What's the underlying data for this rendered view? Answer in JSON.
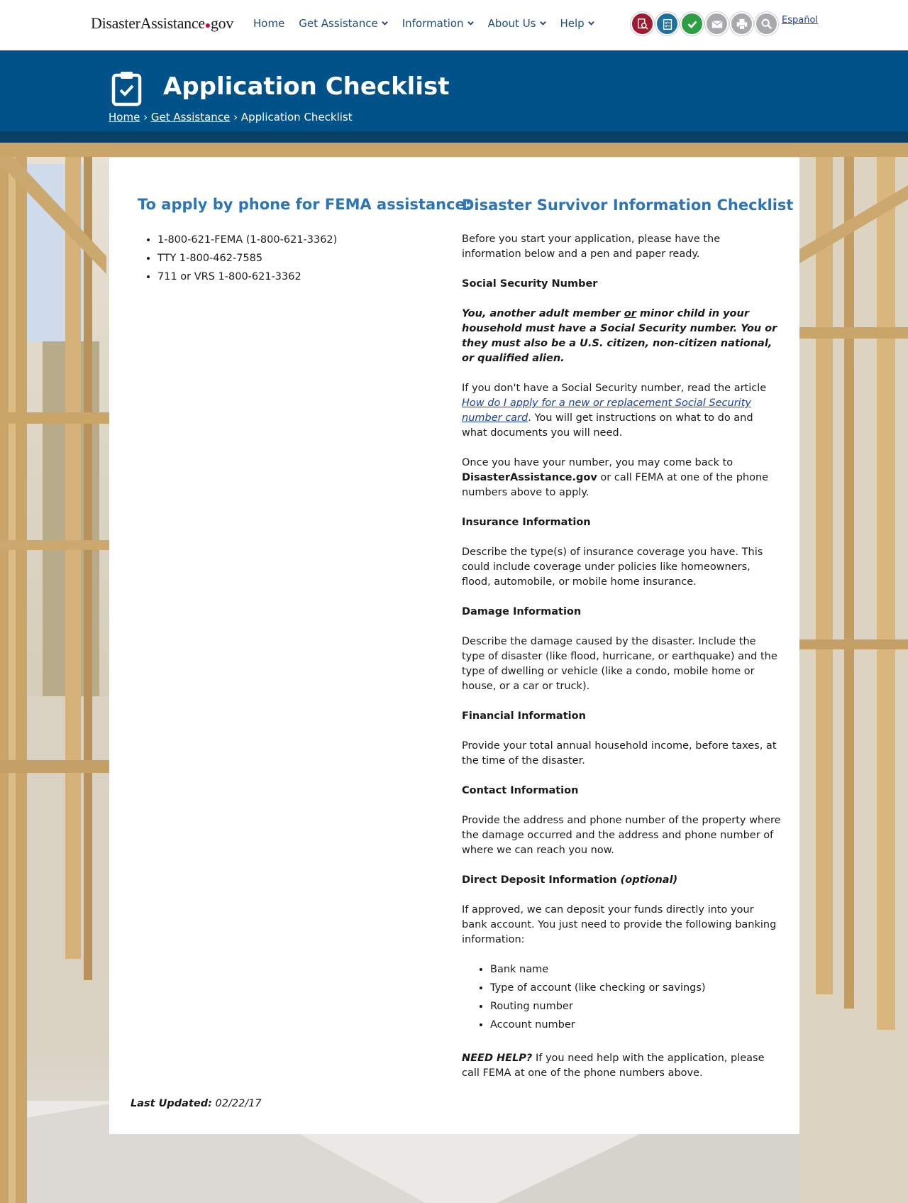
{
  "header": {
    "logo_main": "DisasterAssistance",
    "logo_dot": "●",
    "logo_suffix": "gov",
    "nav": [
      {
        "label": "Home",
        "dropdown": false
      },
      {
        "label": "Get Assistance",
        "dropdown": true
      },
      {
        "label": "Information",
        "dropdown": true
      },
      {
        "label": "About Us",
        "dropdown": true
      },
      {
        "label": "Help",
        "dropdown": true
      }
    ],
    "tools": [
      {
        "icon": "search-document-icon",
        "color": "#9e1b32"
      },
      {
        "icon": "checklist-icon",
        "color": "#1f6f9f"
      },
      {
        "icon": "checkmark-icon",
        "color": "#2e9e44"
      },
      {
        "icon": "email-icon",
        "color": "#a7a9ac"
      },
      {
        "icon": "print-icon",
        "color": "#a7a9ac"
      },
      {
        "icon": "search-icon",
        "color": "#a7a9ac"
      }
    ],
    "language_link": "Español"
  },
  "banner": {
    "title": "Application Checklist",
    "breadcrumb": {
      "home": "Home",
      "sep1": "›",
      "get_assistance": "Get Assistance",
      "sep2": "›",
      "current": "Application Checklist"
    }
  },
  "left": {
    "heading": "To apply by phone for FEMA assistance:",
    "phones": [
      "1-800-621-FEMA (1-800-621-3362)",
      "TTY 1-800-462-7585",
      "711 or VRS 1-800-621-3362"
    ]
  },
  "right": {
    "heading": "Disaster Survivor Information Checklist",
    "intro": "Before you start your application, please have the information below and a pen and paper ready.",
    "ssn": {
      "title": "Social Security Number",
      "emph_a": "You, another adult member ",
      "emph_or": "or",
      "emph_b": " minor child in your household must have a Social Security number. You or they must also be a U.S. citizen, non-citizen national, or qualified alien.",
      "no_ssn_a": "If you don't have a Social Security number, read the article ",
      "no_ssn_link": "How do I apply for a new or replacement Social Security number card",
      "no_ssn_b": ". You will get instructions on what to do and what documents you will need.",
      "return_a": "Once you have your number, you may come back to ",
      "return_site": "DisasterAssistance.gov",
      "return_b": " or call FEMA at one of the phone numbers above to apply."
    },
    "insurance": {
      "title": "Insurance Information",
      "text": "Describe the type(s) of insurance coverage you have. This could include coverage under policies like homeowners, flood, automobile, or mobile home insurance."
    },
    "damage": {
      "title": "Damage Information",
      "text": "Describe the damage caused by the disaster. Include the type of disaster (like flood, hurricane, or earthquake) and the type of dwelling or vehicle (like a condo, mobile home or house, or a car or truck)."
    },
    "financial": {
      "title": "Financial Information",
      "text": "Provide your total annual household income, before taxes, at the time of the disaster."
    },
    "contact": {
      "title": "Contact Information",
      "text": "Provide the address and phone number of the property where the damage occurred and the address and phone number of where we can reach you now."
    },
    "deposit": {
      "title": "Direct Deposit Information",
      "optional": "(optional)",
      "text": "If approved, we can deposit your funds directly into your bank account. You just need to provide the following banking information:",
      "items": [
        "Bank name",
        "Type of account (like checking or savings)",
        "Routing number",
        "Account number"
      ]
    },
    "help": {
      "label": "NEED HELP?",
      "text": " If you need help with the application, please call FEMA at one of the phone numbers above."
    }
  },
  "footer": {
    "updated_label": "Last Updated:",
    "updated_date": " 02/22/17"
  }
}
